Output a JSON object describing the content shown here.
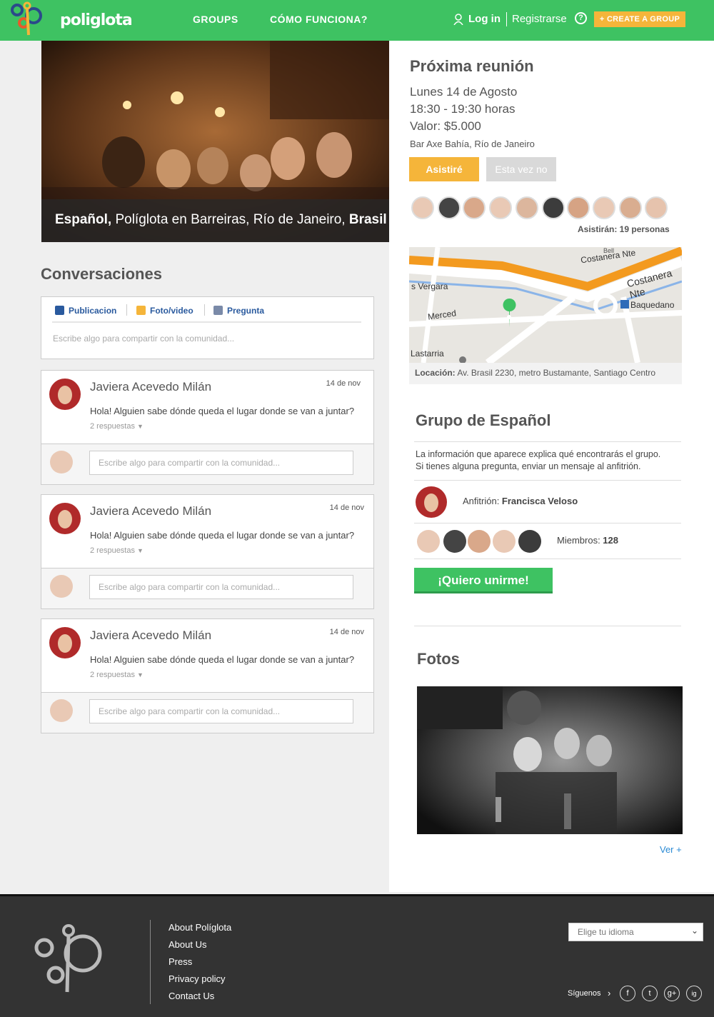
{
  "header": {
    "logo_text": "poliglota",
    "nav": [
      "GROUPS",
      "CÓMO FUNCIONA?"
    ],
    "login": "Log in",
    "register": "Registrarse",
    "help": "?",
    "create_group": "+ CREATE A GROUP"
  },
  "hero": {
    "lang": "Español,",
    "mid": " Políglota en Barreiras, Río de Janeiro, ",
    "country": "Brasil"
  },
  "meeting": {
    "title": "Próxima reunión",
    "date": "Lunes 14 de Agosto",
    "time": "18:30 - 19:30 horas",
    "price": "Valor: $5.000",
    "place": "Bar Axe Bahía, Río de Janeiro",
    "attend": "Asistiré",
    "decline": "Esta vez no",
    "attending": "Asistirán: 19 personas"
  },
  "map": {
    "labels": [
      "Costanera Nte",
      "Costanera Nte",
      "s Vergara",
      "Merced",
      "Baquedano",
      "Lastarria",
      "Bell"
    ],
    "location_label": "Locación:",
    "location": " Av. Brasil 2230, metro Bustamante,  Santiago Centro"
  },
  "group": {
    "title": "Grupo de Español",
    "info1": "La información que aparece explica qué encontrarás el grupo.",
    "info2": "Si tienes alguna pregunta, enviar un mensaje al anfitrión.",
    "host_label": "Anfitrión: ",
    "host": "Francisca Veloso",
    "members_label": "Miembros: ",
    "members": "128",
    "join": "¡Quiero unirme!"
  },
  "photos": {
    "title": "Fotos",
    "more": "Ver +"
  },
  "conversations": {
    "title": "Conversaciones",
    "tabs": [
      "Publicacion",
      "Foto/video",
      "Pregunta"
    ],
    "placeholder": "Escribe algo para compartir con la comunidad...",
    "posts": [
      {
        "author": "Javiera Acevedo Milán",
        "date": "14 de nov",
        "text": "Hola! Alguien sabe dónde queda el lugar donde se van a juntar?",
        "replies": "2 respuestas",
        "reply_placeholder": "Escribe algo para compartir con la comunidad..."
      },
      {
        "author": "Javiera Acevedo Milán",
        "date": "14 de nov",
        "text": "Hola! Alguien sabe dónde queda el lugar donde se van a juntar?",
        "replies": "2 respuestas",
        "reply_placeholder": "Escribe algo para compartir con la comunidad..."
      },
      {
        "author": "Javiera Acevedo Milán",
        "date": "14 de nov",
        "text": "Hola! Alguien sabe dónde queda el lugar donde se van a juntar?",
        "replies": "2 respuestas",
        "reply_placeholder": "Escribe algo para compartir con la comunidad..."
      }
    ]
  },
  "footer": {
    "links": [
      "About Políglota",
      "About Us",
      "Press",
      "Privacy policy",
      "Contact Us"
    ],
    "language_select": "Elige tu idioma",
    "follow": "Síguenos",
    "social": [
      "f",
      "t",
      "g+",
      "ig"
    ]
  }
}
